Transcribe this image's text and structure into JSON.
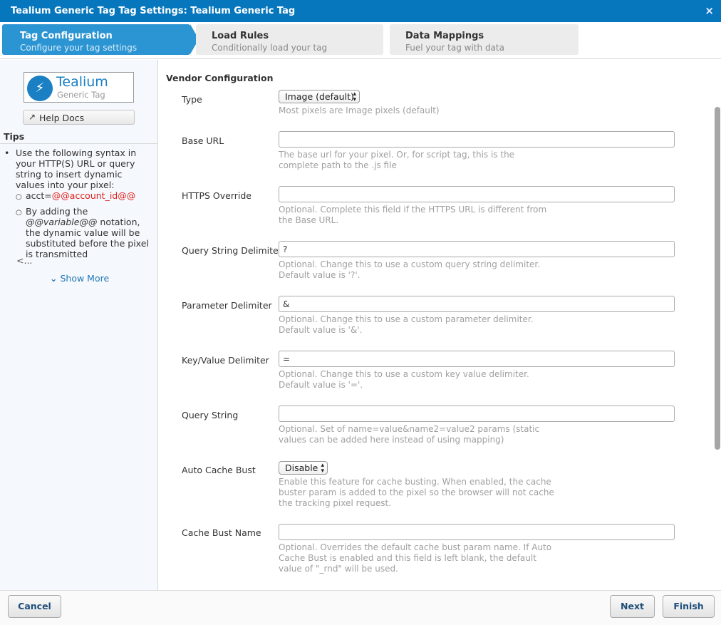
{
  "dialog": {
    "title": "Tealium Generic Tag Tag Settings: Tealium Generic Tag",
    "close_icon": "×"
  },
  "steps": [
    {
      "title": "Tag Configuration",
      "subtitle": "Configure your tag settings",
      "active": true
    },
    {
      "title": "Load Rules",
      "subtitle": "Conditionally load your tag",
      "active": false
    },
    {
      "title": "Data Mappings",
      "subtitle": "Fuel your tag with data",
      "active": false
    }
  ],
  "sidebar": {
    "logo": {
      "name": "Tealium",
      "subtitle": "Generic Tag",
      "icon": "⚡"
    },
    "help_docs": {
      "icon": "↗",
      "label": "Help Docs"
    },
    "tips_title": "Tips",
    "tips": {
      "bullet": "•",
      "sub_bullet": "○",
      "main": "Use the following syntax in your HTTP(S) URL or query string to insert dynamic values into your pixel:",
      "example_prefix": "acct=",
      "example_var": "@@account_id@@",
      "note_prefix": "By adding the ",
      "note_var": "@@variable@@",
      "note_suffix": " notation, the dynamic value will be substituted before the pixel is transmitted"
    },
    "ellipsis": "<...",
    "show_more": {
      "icon": "⌄",
      "label": "Show More"
    }
  },
  "form": {
    "section_title": "Vendor Configuration",
    "fields": {
      "type": {
        "label": "Type",
        "value": "Image (default)",
        "help": "Most pixels are Image pixels (default)"
      },
      "base_url": {
        "label": "Base URL",
        "value": "",
        "help": "The base url for your pixel. Or, for script tag, this is the complete path to the .js file"
      },
      "https_override": {
        "label": "HTTPS Override",
        "value": "",
        "help": "Optional. Complete this field if the HTTPS URL is different from the Base URL."
      },
      "query_string_delimiter": {
        "label": "Query String Delimiter",
        "value": "?",
        "help": "Optional. Change this to use a custom query string delimiter. Default value is '?'."
      },
      "parameter_delimiter": {
        "label": "Parameter Delimiter",
        "value": "&",
        "help": "Optional. Change this to use a custom parameter delimiter. Default value is '&'."
      },
      "key_value_delimiter": {
        "label": "Key/Value Delimiter",
        "value": "=",
        "help": "Optional. Change this to use a custom key value delimiter. Default value is '='."
      },
      "query_string": {
        "label": "Query String",
        "value": "",
        "help": "Optional. Set of name=value&name2=value2 params (static values can be added here instead of using mapping)"
      },
      "auto_cache_bust": {
        "label": "Auto Cache Bust",
        "value": "Disable",
        "help": "Enable this feature for cache busting. When enabled, the cache buster param is added to the pixel so the browser will not cache the tracking pixel request."
      },
      "cache_bust_name": {
        "label": "Cache Bust Name",
        "value": "",
        "help": "Optional. Overrides the default cache bust param name. If Auto Cache Bust is enabled and this field is left blank, the default value of \"_rnd\" will be used."
      }
    },
    "select_arrows": "▲▼"
  },
  "footer": {
    "cancel": "Cancel",
    "next": "Next",
    "finish": "Finish"
  }
}
